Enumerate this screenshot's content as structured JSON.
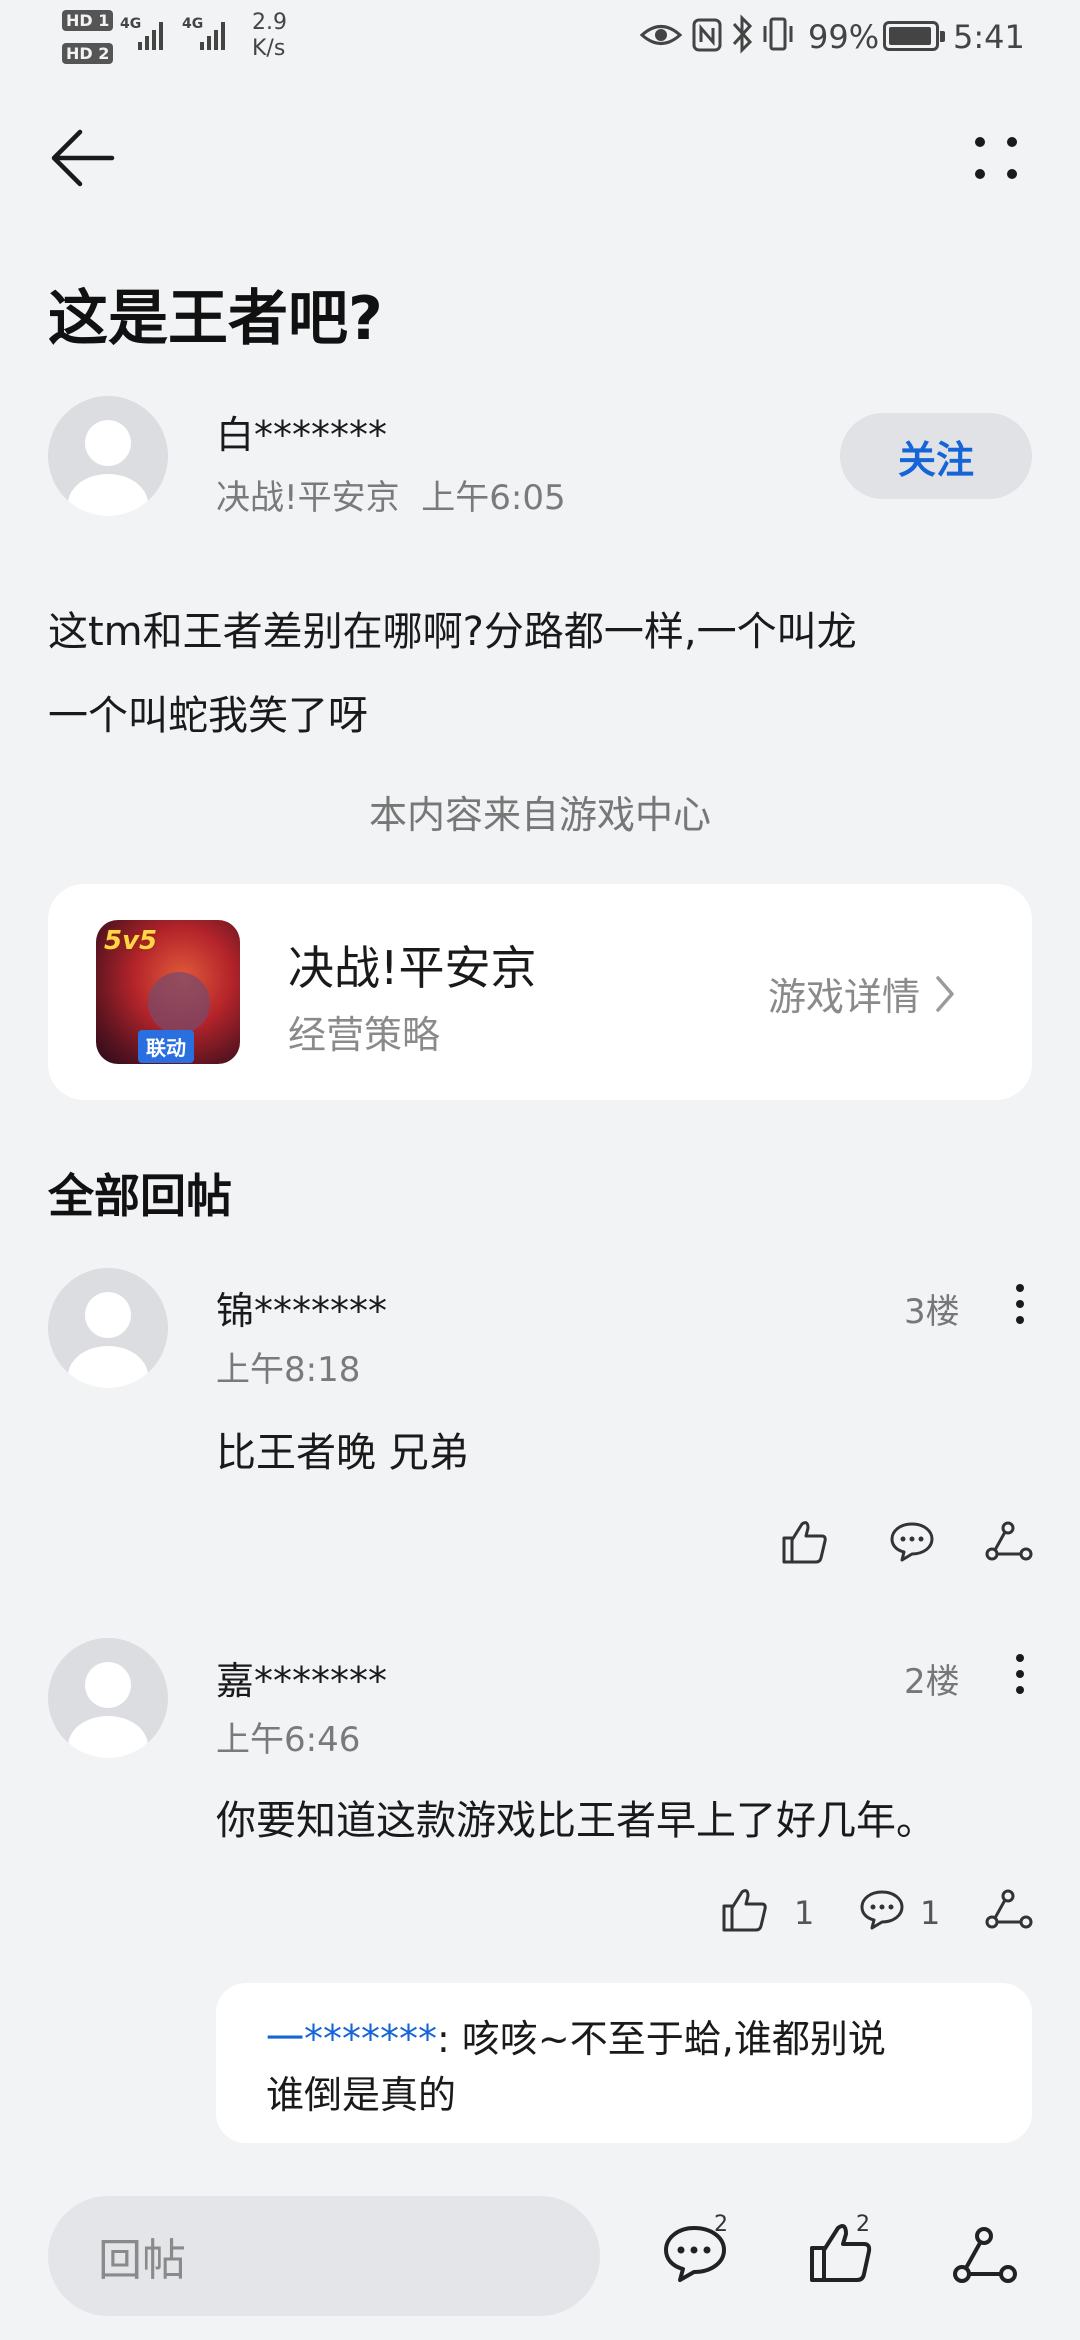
{
  "status_bar": {
    "hd1": "HD 1",
    "hd2": "HD 2",
    "net_type_1": "4G",
    "net_type_2": "4G",
    "speed_value": "2.9",
    "speed_unit": "K/s",
    "battery_pct": "99%",
    "time": "5:41",
    "icons": [
      "eye-icon",
      "nfc-icon",
      "bluetooth-icon",
      "vibrate-icon",
      "battery-icon"
    ]
  },
  "nav": {
    "back_icon": "back-arrow-icon",
    "more_icon": "more-dots-icon"
  },
  "post": {
    "title": "这是王者吧?",
    "author": "白*******",
    "game": "决战!平安京",
    "time": "上午6:05",
    "follow_label": "关注",
    "body_line1": "这tm和王者差别在哪啊?分路都一样,一个叫龙",
    "body_line2": "一个叫蛇我笑了呀",
    "source_note": "本内容来自游戏中心"
  },
  "game_card": {
    "icon_badge": "5v5",
    "icon_tag": "联动",
    "name": "决战!平安京",
    "genre": "经营策略",
    "detail_label": "游戏详情"
  },
  "replies_section": {
    "title": "全部回帖"
  },
  "replies": [
    {
      "author": "锦*******",
      "time": "上午8:18",
      "floor": "3楼",
      "text": "比王者晚  兄弟",
      "likes": "",
      "comments": ""
    },
    {
      "author": "嘉*******",
      "time": "上午6:46",
      "floor": "2楼",
      "text": "你要知道这款游戏比王者早上了好几年。",
      "likes": "1",
      "comments": "1",
      "sub_reply": {
        "author": "一*******",
        "sep": ":",
        "text_line1": "咳咳~不至于蛤,谁都别说",
        "text_line2": "谁倒是真的"
      }
    }
  ],
  "bottom_bar": {
    "input_placeholder": "回帖",
    "comment_count": "2",
    "like_count": "2"
  },
  "colors": {
    "accent": "#1565d8",
    "background": "#f1f3f5",
    "card": "#ffffff"
  }
}
